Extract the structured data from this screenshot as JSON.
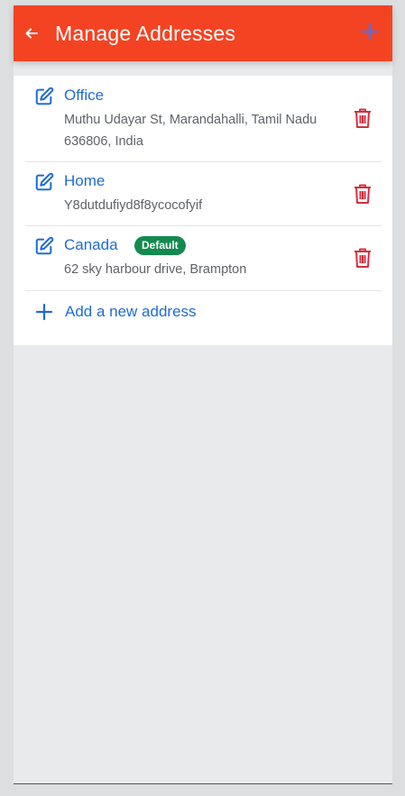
{
  "header": {
    "title": "Manage Addresses",
    "back_icon": "back-arrow-icon",
    "add_icon": "plus-icon"
  },
  "addresses": [
    {
      "name": "Office",
      "line1": "Muthu Udayar St, Marandahalli, Tamil Nadu",
      "line2": "636806, India",
      "default": false
    },
    {
      "name": "Home",
      "line1": "Y8dutdufiyd8f8ycocofyif",
      "line2": "",
      "default": false
    },
    {
      "name": "Canada",
      "line1": "62 sky harbour drive, Brampton",
      "line2": "",
      "default": true,
      "badge": "Default"
    }
  ],
  "add_new": {
    "label": "Add a new address"
  },
  "colors": {
    "header_bg": "#f44322",
    "link_blue": "#1f6bd6",
    "trash_red": "#d32f3f",
    "badge_green": "#138a4e",
    "header_plus": "#5b6fd8"
  }
}
